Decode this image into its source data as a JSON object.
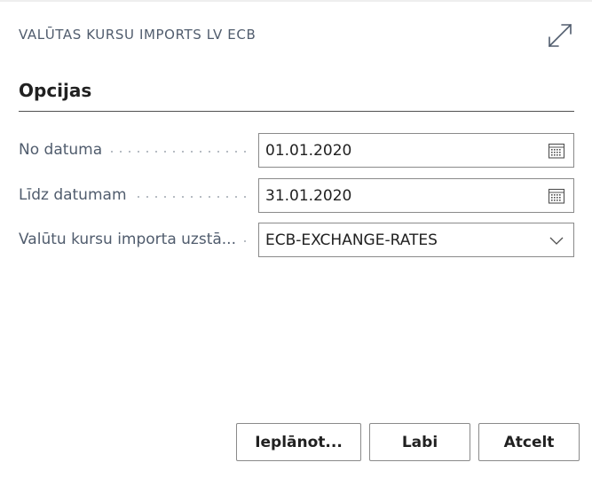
{
  "dialog": {
    "caption": "VALŪTAS KURSU IMPORTS LV ECB",
    "expand_icon": "expand-diagonal-icon"
  },
  "section": {
    "title": "Opcijas"
  },
  "fields": [
    {
      "label": "No datuma",
      "value": "01.01.2020",
      "icon": "calendar-icon"
    },
    {
      "label": "Līdz datumam",
      "value": "31.01.2020",
      "icon": "calendar-icon"
    },
    {
      "label": "Valūtu kursu importa uzstā...",
      "value": "ECB-EXCHANGE-RATES",
      "icon": "chevron-down-icon"
    }
  ],
  "buttons": {
    "schedule": "Ieplānot...",
    "ok": "Labi",
    "cancel": "Atcelt"
  },
  "colors": {
    "caption": "#505c6d",
    "label": "#505c6d",
    "border": "#8a8a8a",
    "text": "#212121"
  }
}
